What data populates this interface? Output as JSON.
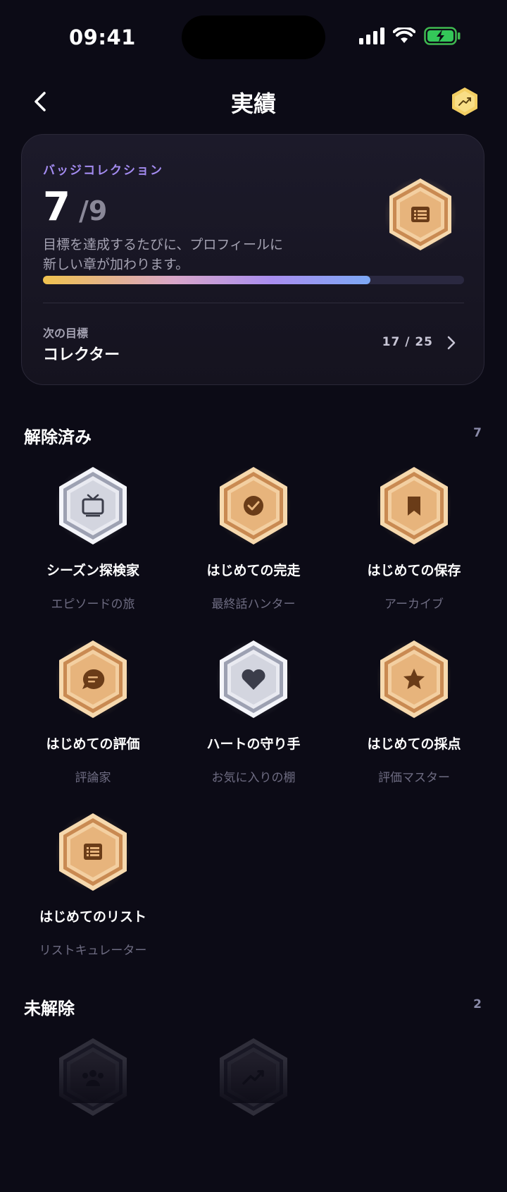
{
  "status": {
    "time": "09:41"
  },
  "nav": {
    "title": "実績"
  },
  "summary": {
    "eyebrow": "バッジコレクション",
    "unlocked": "7",
    "separator": "/",
    "total": "9",
    "progress_fraction": 0.778,
    "description_line1": "目標を達成するたびに、プロフィールに",
    "description_line2": "新しい章が加わります。",
    "next_label": "次の目標",
    "next_name": "コレクター",
    "next_progress": "17 / 25"
  },
  "unlocked_section": {
    "title": "解除済み",
    "count": "7",
    "badges": [
      {
        "name": "シーズン探検家",
        "subtitle": "エピソードの旅",
        "tier": "silver",
        "icon": "tv-icon"
      },
      {
        "name": "はじめての完走",
        "subtitle": "最終話ハンター",
        "tier": "gold",
        "icon": "check-circle-icon"
      },
      {
        "name": "はじめての保存",
        "subtitle": "アーカイブ",
        "tier": "gold",
        "icon": "bookmark-icon"
      },
      {
        "name": "はじめての評価",
        "subtitle": "評論家",
        "tier": "gold",
        "icon": "chat-bubble-icon"
      },
      {
        "name": "ハートの守り手",
        "subtitle": "お気に入りの棚",
        "tier": "silver",
        "icon": "heart-icon"
      },
      {
        "name": "はじめての採点",
        "subtitle": "評価マスター",
        "tier": "gold",
        "icon": "star-icon"
      },
      {
        "name": "はじめてのリスト",
        "subtitle": "リストキュレーター",
        "tier": "gold",
        "icon": "list-icon"
      }
    ]
  },
  "locked_section": {
    "title": "未解除",
    "count": "2",
    "badges": [
      {
        "icon": "users-icon"
      },
      {
        "icon": "trending-up-icon"
      }
    ]
  },
  "colors": {
    "background": "#0c0b16",
    "accent_purple": "#a38bf0",
    "gold": "#e6b37a",
    "silver": "#d9dbe6"
  }
}
